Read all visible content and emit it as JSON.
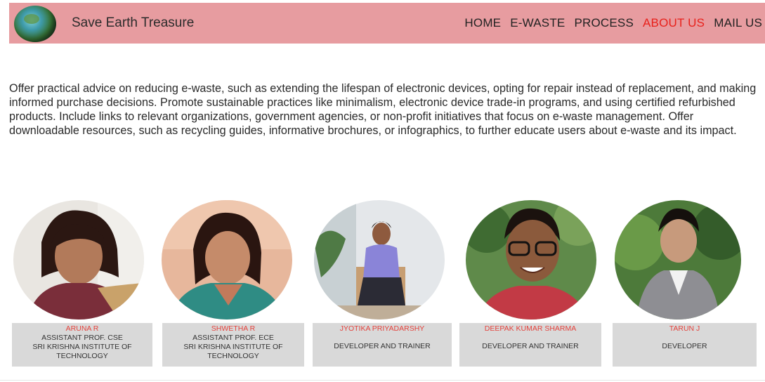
{
  "header": {
    "brand": "Save Earth Treasure",
    "nav": [
      {
        "label": "HOME",
        "active": false
      },
      {
        "label": "E-WASTE",
        "active": false
      },
      {
        "label": "PROCESS",
        "active": false
      },
      {
        "label": "ABOUT US",
        "active": true
      },
      {
        "label": "MAIL US",
        "active": false
      }
    ],
    "colors": {
      "nav_bg": "#e79ca0",
      "active": "#e8211b"
    }
  },
  "intro": {
    "text": "Offer practical advice on reducing e-waste, such as extending the lifespan of electronic devices, opting for repair instead of replacement, and making informed purchase decisions. Promote sustainable practices like minimalism, electronic device trade-in programs, and using certified refurbished products. Include links to relevant organizations, government agencies, or non-profit initiatives that focus on e-waste management. Offer downloadable resources, such as recycling guides, informative brochures, or infographics, to further educate users about e-waste and its impact."
  },
  "team": [
    {
      "name": "ARUNA R",
      "role1": "ASSISTANT PROF. CSE",
      "role2": "SRI KRISHNA INSTITUTE OF",
      "role3": "TECHNOLOGY"
    },
    {
      "name": "SHWETHA R",
      "role1": "ASSISTANT PROF. ECE",
      "role2": "SRI KRISHNA INSTITUTE OF",
      "role3": "TECHNOLOGY"
    },
    {
      "name": "JYOTIKA PRIYADARSHY",
      "role": "DEVELOPER AND TRAINER"
    },
    {
      "name": "DEEPAK KUMAR SHARMA",
      "role": "DEVELOPER AND TRAINER"
    },
    {
      "name": "TARUN J",
      "role": "DEVELOPER"
    }
  ]
}
